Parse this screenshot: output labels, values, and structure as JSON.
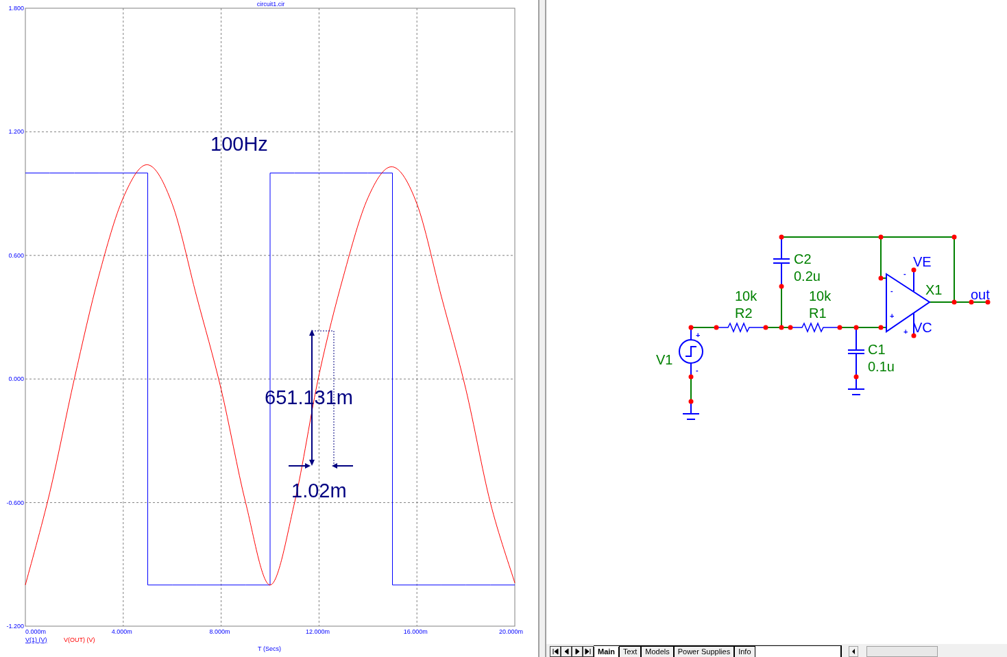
{
  "plot": {
    "chart_data": {
      "type": "line",
      "title": "circuit1.cir",
      "xlabel": "T (Secs)",
      "x": [
        0,
        1,
        2,
        3,
        4,
        5,
        5,
        6,
        7,
        8,
        9,
        10,
        10,
        11,
        12,
        13,
        14,
        15,
        15,
        16,
        17,
        18,
        19,
        20
      ],
      "series": [
        {
          "name": "V(1) (V)",
          "color": "#0000ff",
          "values": [
            1,
            1,
            1,
            1,
            1,
            1,
            -1,
            -1,
            -1,
            -1,
            -1,
            -1,
            1,
            1,
            1,
            1,
            1,
            1,
            -1,
            -1,
            -1,
            -1,
            -1,
            -1
          ]
        },
        {
          "name": "V(OUT) (V)",
          "color": "#ff0000",
          "values": [
            -1,
            -0.55,
            0,
            0.5,
            0.88,
            1.04,
            1.04,
            0.85,
            0.4,
            -0.05,
            -0.6,
            -1.0,
            -1.0,
            -0.6,
            0.02,
            0.5,
            0.88,
            1.03,
            1.03,
            0.85,
            0.4,
            -0.05,
            -0.6,
            -0.99
          ]
        }
      ],
      "xlim": [
        0,
        20
      ],
      "ylim": [
        -1.2,
        1.8
      ],
      "xticks": [
        {
          "value": 0,
          "label": "0.000m"
        },
        {
          "value": 4,
          "label": "4.000m"
        },
        {
          "value": 8,
          "label": "8.000m"
        },
        {
          "value": 12,
          "label": "12.000m"
        },
        {
          "value": 16,
          "label": "16.000m"
        },
        {
          "value": 20,
          "label": "20.000m"
        }
      ],
      "yticks": [
        {
          "value": 1.8,
          "label": "1.800"
        },
        {
          "value": 1.2,
          "label": "1.200"
        },
        {
          "value": 0.6,
          "label": "0.600"
        },
        {
          "value": 0,
          "label": "0.000"
        },
        {
          "value": -0.6,
          "label": "-0.600"
        },
        {
          "value": -1.2,
          "label": "-1.200"
        }
      ],
      "grid": true,
      "annotations": [
        "100Hz",
        "651.131m",
        "1.02m"
      ]
    }
  },
  "schematic": {
    "labels": [
      {
        "text": "C2",
        "kind": "part"
      },
      {
        "text": "0.2u",
        "kind": "part"
      },
      {
        "text": "10k",
        "kind": "part"
      },
      {
        "text": "R2",
        "kind": "part"
      },
      {
        "text": "10k",
        "kind": "part"
      },
      {
        "text": "R1",
        "kind": "part"
      },
      {
        "text": "X1",
        "kind": "part"
      },
      {
        "text": "V1",
        "kind": "part"
      },
      {
        "text": "C1",
        "kind": "part"
      },
      {
        "text": "0.1u",
        "kind": "part"
      },
      {
        "text": "VE",
        "kind": "net"
      },
      {
        "text": "VC",
        "kind": "net"
      },
      {
        "text": "out",
        "kind": "net"
      },
      {
        "text": "+",
        "kind": "pin"
      },
      {
        "text": "-",
        "kind": "pin"
      },
      {
        "text": "-",
        "kind": "pin"
      },
      {
        "text": "+",
        "kind": "pin"
      },
      {
        "text": "-",
        "kind": "pin"
      },
      {
        "text": "+",
        "kind": "pin"
      }
    ]
  },
  "tabs": [
    {
      "label": "Main",
      "selected": true
    },
    {
      "label": "Text",
      "selected": false
    },
    {
      "label": "Models",
      "selected": false
    },
    {
      "label": "Power Supplies",
      "selected": false
    },
    {
      "label": "Info",
      "selected": false
    }
  ]
}
